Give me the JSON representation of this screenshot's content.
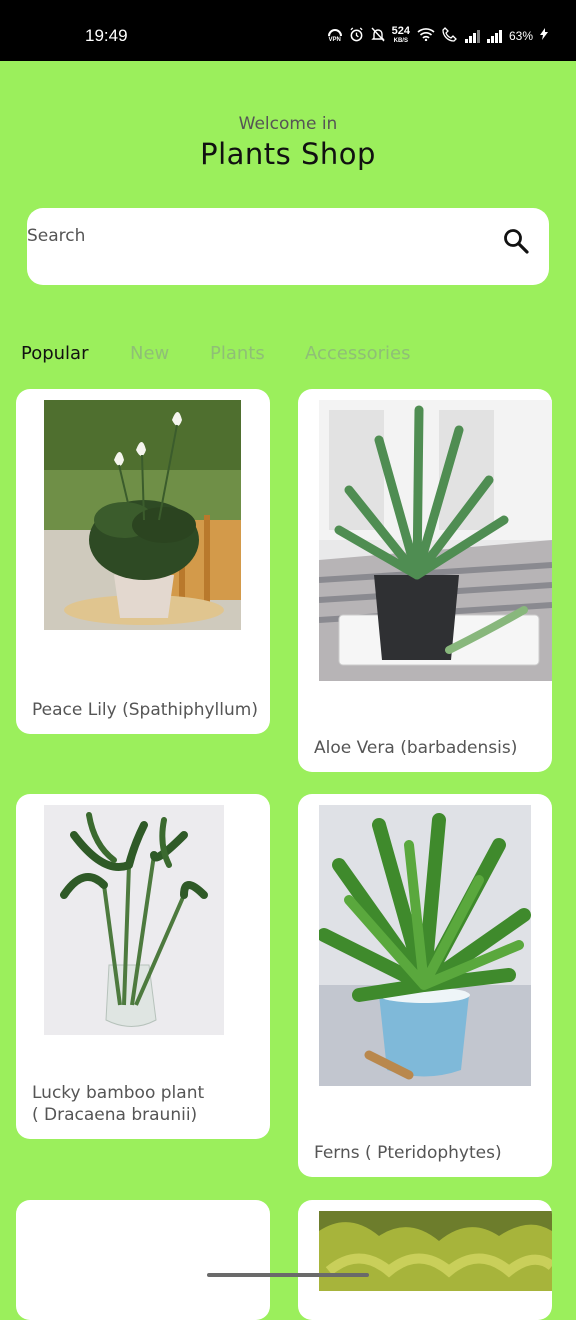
{
  "status_bar": {
    "time": "19:49",
    "vpn": "VPN",
    "speed": "524",
    "speed_unit": "KB/S",
    "battery": "63%"
  },
  "header": {
    "welcome": "Welcome in",
    "title": "Plants Shop"
  },
  "search": {
    "placeholder": "Search"
  },
  "tabs": [
    {
      "label": "Popular",
      "active": true
    },
    {
      "label": "New",
      "active": false
    },
    {
      "label": "Plants",
      "active": false
    },
    {
      "label": "Accessories",
      "active": false
    }
  ],
  "products": [
    {
      "label": "Peace Lily (Spathiphyllum)"
    },
    {
      "label": "Aloe Vera (barbadensis)"
    },
    {
      "label": "Lucky bamboo plant\n( Dracaena braunii)"
    },
    {
      "label": "Ferns ( Pteridophytes)"
    }
  ],
  "colors": {
    "background": "#9bef5c",
    "card": "#ffffff",
    "status_bar": "#000000"
  }
}
